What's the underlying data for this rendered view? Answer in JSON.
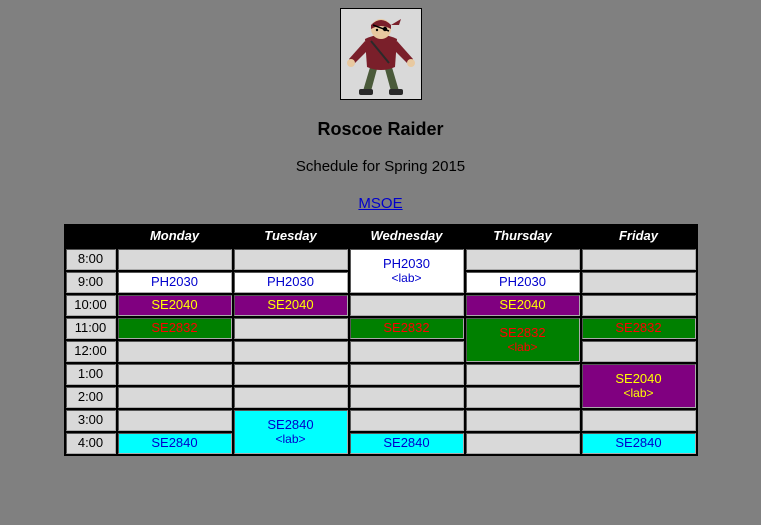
{
  "header": {
    "name": "Roscoe Raider",
    "subtitle": "Schedule for Spring 2015",
    "link_label": "MSOE"
  },
  "days": [
    "Monday",
    "Tuesday",
    "Wednesday",
    "Thursday",
    "Friday"
  ],
  "times": [
    "8:00",
    "9:00",
    "10:00",
    "11:00",
    "12:00",
    "1:00",
    "2:00",
    "3:00",
    "4:00"
  ],
  "courses": {
    "ph2030": "PH2030",
    "ph2030_lab": "PH2030\n<lab>",
    "se2040": "SE2040",
    "se2040_lab": "SE2040\n<lab>",
    "se2832": "SE2832",
    "se2832_lab": "SE2832\n<lab>",
    "se2840": "SE2840",
    "se2840_lab": "SE2840\n<lab>"
  },
  "colors": {
    "page_bg": "#808080",
    "empty_bg": "#d9d9d9",
    "header_bg": "#000000",
    "header_fg": "#ffffff",
    "ph_bg": "#ffffff",
    "ph_fg": "#0000cc",
    "se2040_bg": "#800080",
    "se2040_fg": "#ffff00",
    "se2832_bg": "#008000",
    "se2832_fg": "#ff0000",
    "se2840_bg": "#00ffff",
    "se2840_fg": "#0000cc",
    "link": "#0000cc"
  }
}
